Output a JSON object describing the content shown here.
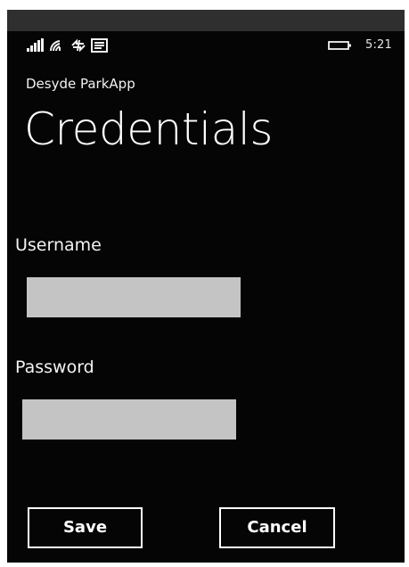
{
  "status_bar": {
    "time": "5:21",
    "icons": [
      "signal-bars-icon",
      "wifi-icon",
      "data-sync-icon",
      "message-icon",
      "battery-icon"
    ]
  },
  "header": {
    "app_name": "Desyde ParkApp",
    "page_title": "Credentials"
  },
  "form": {
    "username": {
      "label": "Username",
      "value": "",
      "placeholder": ""
    },
    "password": {
      "label": "Password",
      "value": "",
      "placeholder": ""
    }
  },
  "actions": {
    "save_label": "Save",
    "cancel_label": "Cancel"
  },
  "colors": {
    "background": "#050505",
    "text": "#ffffff",
    "input_background": "#c4c4c4",
    "top_strip": "#2f2f2f"
  }
}
